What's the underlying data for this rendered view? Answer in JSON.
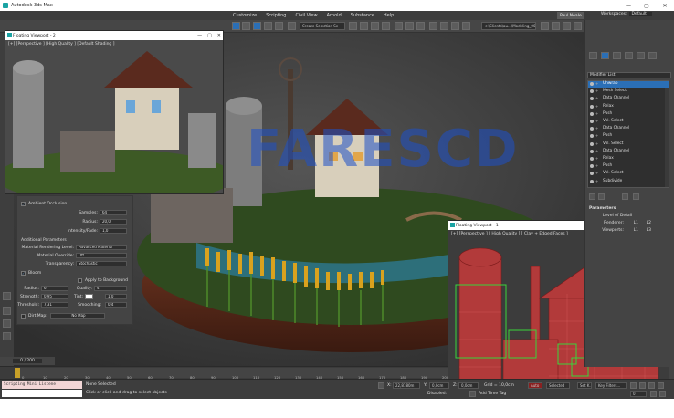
{
  "app": {
    "title": "Autodesk 3ds Max"
  },
  "window_controls": {
    "minimize": "—",
    "maximize": "▢",
    "close": "✕"
  },
  "menu": {
    "items": [
      "Customize",
      "Scripting",
      "Civil View",
      "Arnold",
      "Substance",
      "Help"
    ]
  },
  "user": {
    "name": "Paul Neale"
  },
  "workspaces": {
    "label": "Workspaces:",
    "value": "Default"
  },
  "toolbar": {
    "selection_set": "Create Selection Se",
    "path": "<:\\Clients\\au...\\Modeling_00:"
  },
  "main_viewport": {
    "label": "[+] [Perspective] [High Quality] [Default Shading]"
  },
  "watermark": {
    "text": "FARESCD"
  },
  "floating_viewport_2": {
    "title": "Floating Viewport - 2",
    "label": "[+] [Perspective ] [High Quality ] [Default Shading ]"
  },
  "floating_viewport_1": {
    "title": "Floating Viewport - 1",
    "label": "[+] [Perspective ] [ High Quality ] [ Clay + Edged Faces ]"
  },
  "ao_panel": {
    "ambient_occlusion": "Ambient Occlusion",
    "samples_label": "Samples:",
    "samples_value": "64",
    "radius_label": "Radius:",
    "radius_value": "20,0",
    "intensity_label": "Intensity/Fade:",
    "intensity_value": "1,0",
    "additional": "Additional Parameters",
    "mat_mode_label": "Material Rendering Level:",
    "mat_mode_value": "Advanced Material",
    "mat_override_label": "Material Override:",
    "mat_override_value": "Off",
    "transparency_label": "Transparency:",
    "transparency_value": "Stochastic",
    "bloom": "Bloom",
    "apply_bg": "Apply to Background",
    "radius2_label": "Radius:",
    "radius2_value": "6",
    "quality_label": "Quality:",
    "quality_value": "4",
    "strength_label": "Strength:",
    "strength_value": "0,95",
    "tint_label": "Tint:",
    "tint_value": "1,0",
    "threshold_label": "Threshold:",
    "threshold_value": "7,31",
    "smoothing_label": "Smoothing:",
    "smoothing_value": "0,4",
    "dirt_map": "Dirt Map:",
    "dirt_value": "No Map"
  },
  "command_panel": {
    "modifier_list": "Modifier List",
    "stack": [
      "Unwrap",
      "Mesh Select",
      "Data Channel",
      "Relax",
      "Push",
      "Vol. Select",
      "Data Channel",
      "Push",
      "Vol. Select",
      "Data Channel",
      "Relax",
      "Push",
      "Vol. Select",
      "Subdivide"
    ],
    "parameters": "Parameters",
    "level_of_detail": "Level of Detail",
    "render_label": "Renderer:",
    "viewports_label": "Viewports:",
    "l1": "L1",
    "l2": "L2",
    "l3": "L3"
  },
  "timeline": {
    "frame": "0 / 200",
    "ticks": [
      "0",
      "10",
      "20",
      "30",
      "40",
      "50",
      "60",
      "70",
      "80",
      "90",
      "100",
      "110",
      "120",
      "130",
      "140",
      "150",
      "160",
      "170",
      "180",
      "190",
      "200"
    ]
  },
  "status": {
    "script_label": "Scripting Mini Listene",
    "selection": "None Selected",
    "prompt": "Click or click-and-drag to select objects",
    "x_label": "X:",
    "x_value": "22,8180m",
    "y_label": "Y:",
    "y_value": "0,0cm",
    "z_label": "Z:",
    "z_value": "0,0cm",
    "disabled": "Disabled:",
    "grid": "Grid = 10,0cm",
    "add_time_tag": "Add Time Tag",
    "auto": "Auto",
    "selected": "Selected",
    "set_k": "Set K.",
    "filters": "Key Filters...",
    "frame_field": "0"
  },
  "colors": {
    "accent": "#2b6fb6",
    "watermark": "#1e50c8"
  }
}
